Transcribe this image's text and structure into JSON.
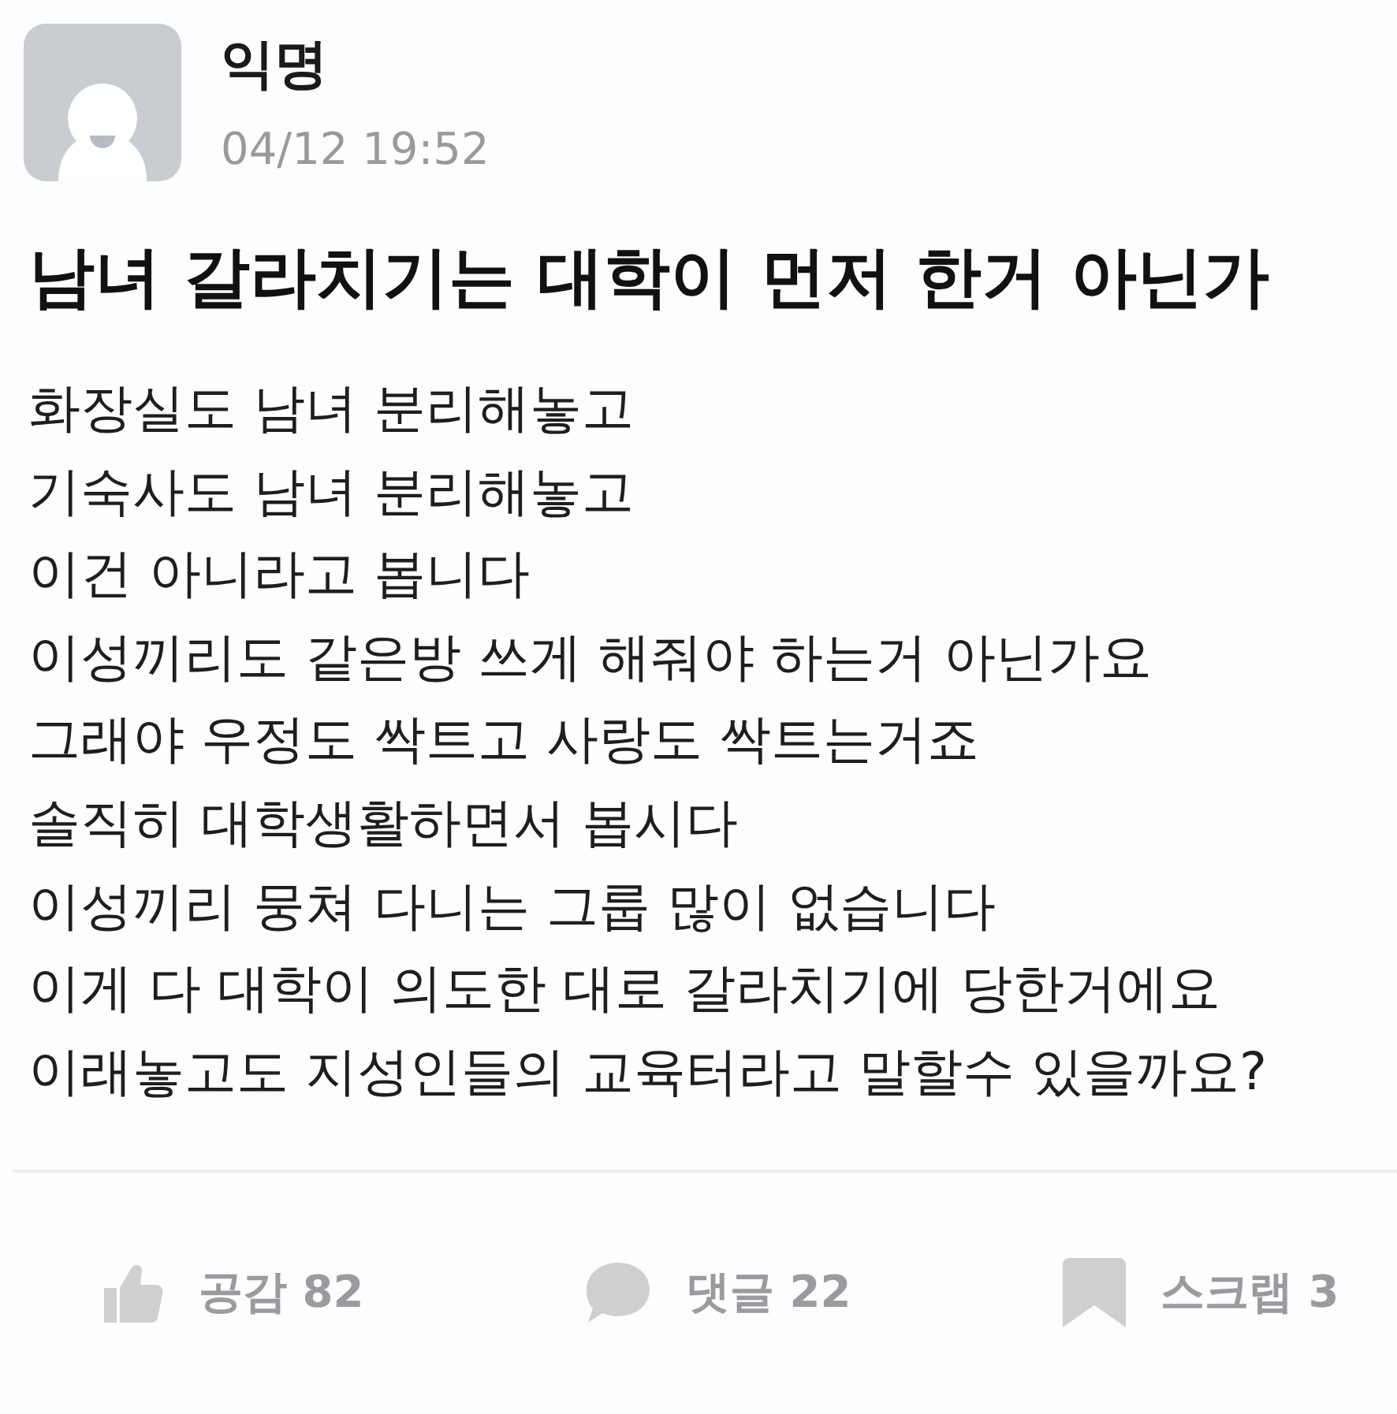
{
  "author": {
    "name": "익명",
    "time": "04/12 19:52"
  },
  "post": {
    "title": "남녀 갈라치기는 대학이 먼저 한거 아닌가",
    "lines": [
      "화장실도 남녀 분리해놓고",
      "기숙사도 남녀 분리해놓고",
      "이건 아니라고 봅니다",
      "이성끼리도 같은방 쓰게 해줘야 하는거 아닌가요",
      "그래야 우정도 싹트고 사랑도 싹트는거죠",
      "솔직히 대학생활하면서 봅시다",
      "이성끼리 뭉쳐 다니는 그룹 많이 없습니다",
      "이게 다 대학이 의도한 대로 갈라치기에 당한거에요",
      "이래놓고도 지성인들의 교육터라고 말할수 있을까요?"
    ]
  },
  "actions": [
    {
      "kind": "like",
      "label": "공감 82"
    },
    {
      "kind": "comment",
      "label": "댓글 22"
    },
    {
      "kind": "scrap",
      "label": "스크랩 3"
    }
  ]
}
